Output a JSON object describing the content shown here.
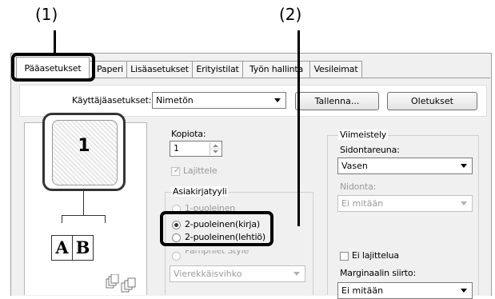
{
  "callouts": {
    "one": "(1)",
    "two": "(2)"
  },
  "tabs": [
    {
      "label": "Pääasetukset",
      "active": true
    },
    {
      "label": "Paperi"
    },
    {
      "label": "Lisäasetukset"
    },
    {
      "label": "Erityistilat"
    },
    {
      "label": "Työn hallinta"
    },
    {
      "label": "Vesileimat"
    }
  ],
  "user_settings": {
    "label": "Käyttäjäasetukset:",
    "value": "Nimetön",
    "save_button": "Tallenna...",
    "defaults_button": "Oletukset"
  },
  "preview": {
    "page_number": "1",
    "booklet_left": "A",
    "booklet_right": "B"
  },
  "copies": {
    "label": "Kopiota:",
    "value": "1"
  },
  "collate": {
    "label": "Lajittele",
    "checked": true,
    "enabled": false
  },
  "document_style": {
    "label": "Asiakirjatyyli",
    "options": [
      {
        "label": "1-puoleinen",
        "selected": false,
        "enabled": false
      },
      {
        "label": "2-puoleinen(kirja)",
        "selected": true,
        "enabled": true
      },
      {
        "label": "2-puoleinen(lehtiö)",
        "selected": false,
        "enabled": true
      },
      {
        "label": "Pamphlet Style",
        "selected": false,
        "enabled": false
      }
    ],
    "pamphlet_value": "Vierekkäisvihko"
  },
  "finishing": {
    "label": "Viimeistely",
    "binding_edge_label": "Sidontareuna:",
    "binding_edge_value": "Vasen",
    "staple_label": "Nidonta:",
    "staple_value": "Ei mitään",
    "no_offset_label": "Ei lajittelua",
    "margin_shift_label": "Marginaalin siirto:",
    "margin_shift_value": "Ei mitään"
  }
}
